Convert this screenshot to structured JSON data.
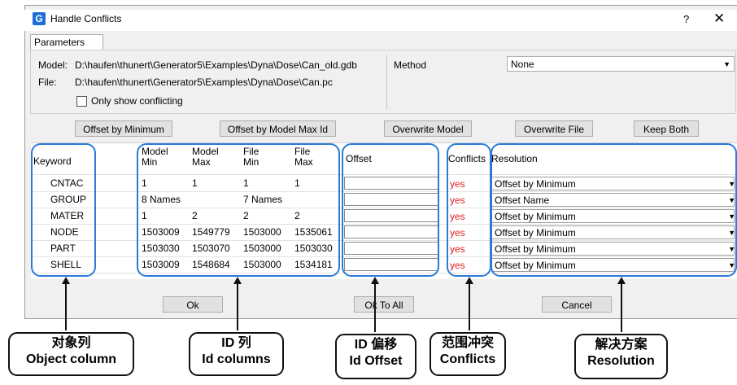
{
  "window": {
    "title": "Handle Conflicts",
    "help": "?",
    "close": "✕",
    "app_icon": "G"
  },
  "tab": {
    "label": "Parameters"
  },
  "params": {
    "model_label": "Model:",
    "model_path": "D:\\haufen\\thunert\\Generator5\\Examples\\Dyna\\Dose\\Can_old.gdb",
    "file_label": "File:",
    "file_path": "D:\\haufen\\thunert\\Generator5\\Examples\\Dyna\\Dose\\Can.pc",
    "only_conflicting": "Only show conflicting",
    "method_label": "Method",
    "method_value": "None"
  },
  "actions": {
    "offset_min": "Offset by Minimum",
    "offset_model_max": "Offset by Model Max Id",
    "overwrite_model": "Overwrite Model",
    "overwrite_file": "Overwrite File",
    "keep_both": "Keep Both"
  },
  "columns": {
    "keyword": "Keyword",
    "model_min": [
      "Model",
      "Min"
    ],
    "model_max": [
      "Model",
      "Max"
    ],
    "file_min": [
      "File",
      "Min"
    ],
    "file_max": [
      "File",
      "Max"
    ],
    "offset": "Offset",
    "conflicts": "Conflicts",
    "resolution": "Resolution"
  },
  "rows": [
    {
      "keyword": "CNTAC",
      "model_min": "1",
      "model_max": "1",
      "file_min": "1",
      "file_max": "1",
      "conflict": "yes",
      "resolution": "Offset by Minimum"
    },
    {
      "keyword": "GROUP",
      "model_min": "8 Names",
      "model_max": "",
      "file_min": "7 Names",
      "file_max": "",
      "conflict": "yes",
      "resolution": "Offset Name"
    },
    {
      "keyword": "MATER",
      "model_min": "1",
      "model_max": "2",
      "file_min": "2",
      "file_max": "2",
      "conflict": "yes",
      "resolution": "Offset by Minimum"
    },
    {
      "keyword": "NODE",
      "model_min": "1503009",
      "model_max": "1549779",
      "file_min": "1503000",
      "file_max": "1535061",
      "conflict": "yes",
      "resolution": "Offset by Minimum"
    },
    {
      "keyword": "PART",
      "model_min": "1503030",
      "model_max": "1503070",
      "file_min": "1503000",
      "file_max": "1503030",
      "conflict": "yes",
      "resolution": "Offset by Minimum"
    },
    {
      "keyword": "SHELL",
      "model_min": "1503009",
      "model_max": "1548684",
      "file_min": "1503000",
      "file_max": "1534181",
      "conflict": "yes",
      "resolution": "Offset by Minimum"
    }
  ],
  "footer": {
    "ok": "Ok",
    "ok_all": "Ok To All",
    "cancel": "Cancel"
  },
  "annotations": [
    {
      "zh": "对象列",
      "en": "Object column"
    },
    {
      "zh": "ID 列",
      "en": "Id columns"
    },
    {
      "zh": "ID 偏移",
      "en": "Id Offset"
    },
    {
      "zh": "范围冲突",
      "en": "Conflicts"
    },
    {
      "zh": "解决方案",
      "en": "Resolution"
    }
  ],
  "colors": {
    "highlight": "#2b7bd6",
    "conflict": "#e02020",
    "app_icon": "#1e6fd8"
  }
}
